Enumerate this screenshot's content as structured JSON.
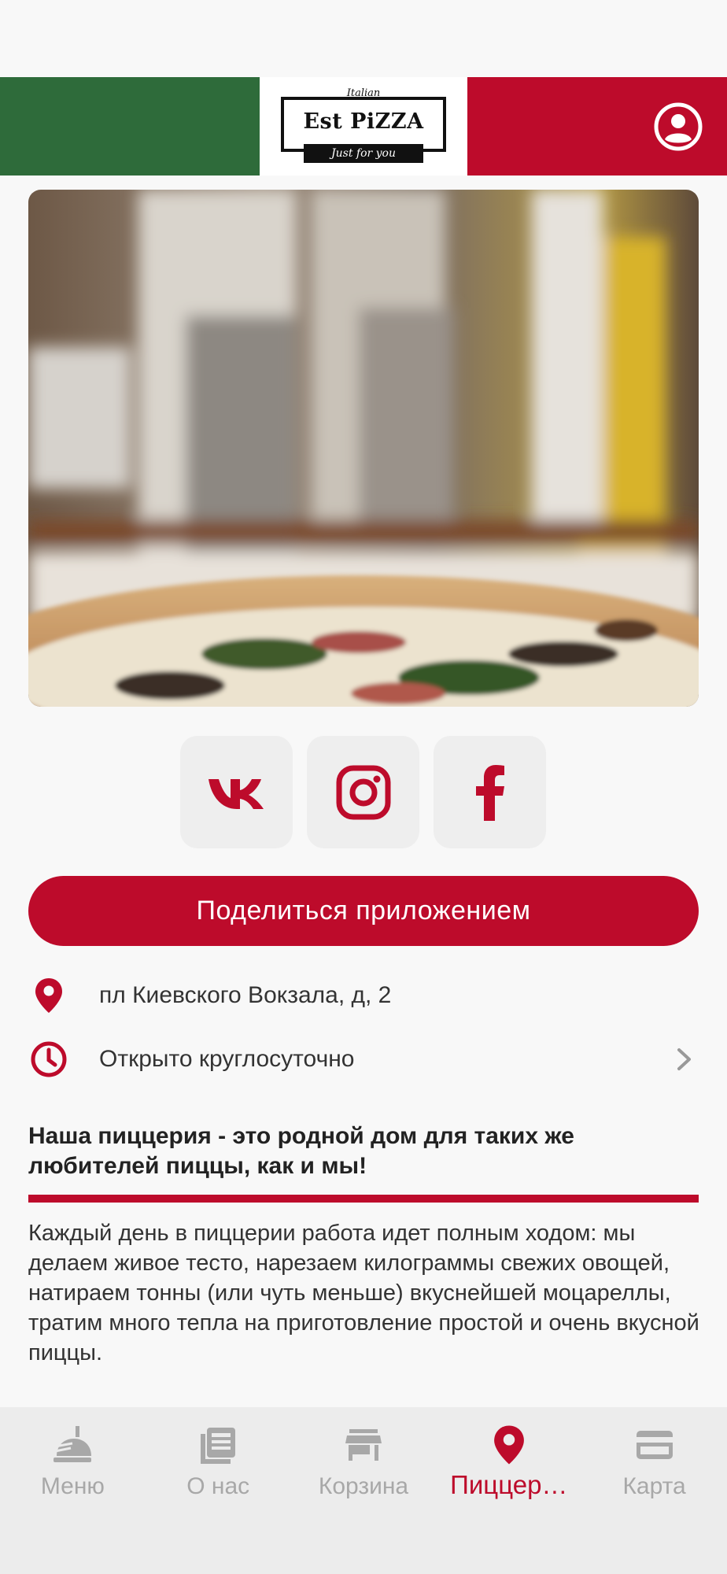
{
  "colors": {
    "accent": "#bd0b2b",
    "green": "#2e6b3a",
    "inactive": "#a8a8a8"
  },
  "header": {
    "logo_top": "Italian",
    "logo_main": "Est PiZZA",
    "logo_sub": "Just for you",
    "profile_icon": "profile-icon"
  },
  "socials": [
    {
      "name": "vk",
      "icon": "vk-icon"
    },
    {
      "name": "instagram",
      "icon": "instagram-icon"
    },
    {
      "name": "facebook",
      "icon": "facebook-icon"
    }
  ],
  "share_label": "Поделиться приложением",
  "address": "пл Киевского Вокзала, д, 2",
  "hours": "Открыто круглосуточно",
  "about": {
    "title": "Наша пиццерия - это  родной дом для таких же любителей пиццы, как и мы!",
    "text": "Каждый день в пиццерии работа идет полным ходом: мы делаем живое тесто, нарезаем килограммы свежих овощей, натираем тонны (или чуть меньше) вкуснейшей моцареллы, тратим много тепла на приготовление простой и очень вкусной пиццы."
  },
  "tabs": [
    {
      "label": "Меню",
      "icon": "menu-icon",
      "active": false
    },
    {
      "label": "О нас",
      "icon": "about-icon",
      "active": false
    },
    {
      "label": "Корзина",
      "icon": "store-icon",
      "active": false
    },
    {
      "label": "Пиццер…",
      "icon": "location-pin-icon",
      "active": true
    },
    {
      "label": "Карта",
      "icon": "card-icon",
      "active": false
    }
  ]
}
